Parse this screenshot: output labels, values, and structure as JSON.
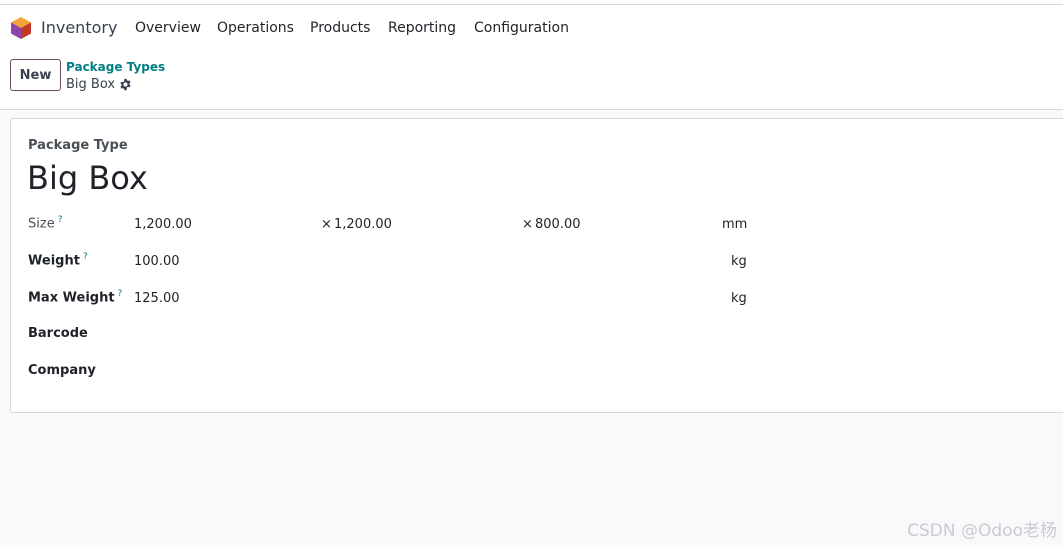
{
  "nav": {
    "app_name": "Inventory",
    "items": [
      "Overview",
      "Operations",
      "Products",
      "Reporting",
      "Configuration"
    ]
  },
  "control": {
    "new_label": "New",
    "breadcrumb_parent": "Package Types",
    "breadcrumb_current": "Big Box"
  },
  "form": {
    "kind_label": "Package Type",
    "name": "Big Box",
    "size": {
      "label": "Size",
      "help": "?",
      "length": "1,200.00",
      "width_prefix": "×",
      "width": "1,200.00",
      "height_prefix": "×",
      "height": "800.00",
      "unit": "mm"
    },
    "weight": {
      "label": "Weight",
      "help": "?",
      "value": "100.00",
      "unit": "kg"
    },
    "max_weight": {
      "label": "Max Weight",
      "help": "?",
      "value": "125.00",
      "unit": "kg"
    },
    "barcode": {
      "label": "Barcode",
      "value": ""
    },
    "company": {
      "label": "Company",
      "value": ""
    }
  },
  "watermark": "CSDN @Odoo老杨",
  "colors": {
    "accent": "#017e84",
    "brand": "#714b67",
    "background": "#f8f9fb"
  }
}
